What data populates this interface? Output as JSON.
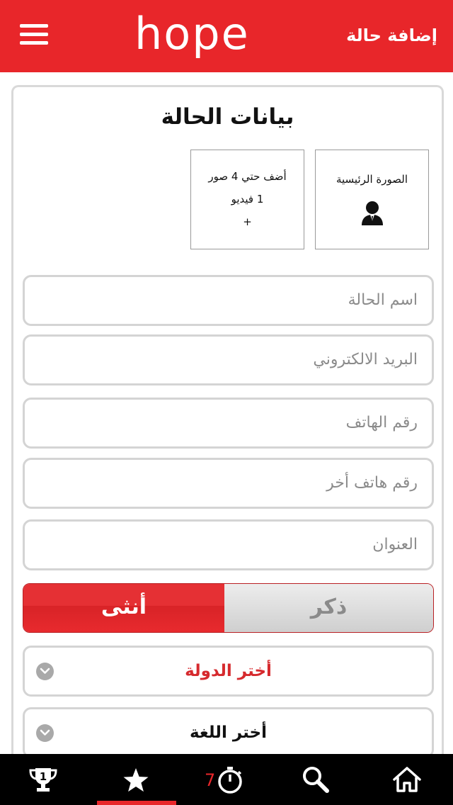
{
  "header": {
    "logo": "hope",
    "title": "إضافة حالة",
    "background": "#e8262a"
  },
  "card": {
    "title": "بيانات الحالة",
    "main_photo_label": "الصورة الرئيسية",
    "more_media": {
      "line1": "أضف حتي  4 صور",
      "line2": "1 فيديو",
      "plus": "+"
    }
  },
  "fields": {
    "case_name": "اسم الحالة",
    "email": "البريد الالكتروني",
    "phone": "رقم الهاتف",
    "phone2": "رقم هاتف أخر",
    "address": "العنوان"
  },
  "gender": {
    "male": "ذكر",
    "female": "أنثى",
    "selected": "female"
  },
  "selects": {
    "country": "أختر الدولة",
    "language": "أختر اللغة"
  },
  "colors": {
    "accent": "#e8262a",
    "country_text": "#d62a2e",
    "language_text": "#111111"
  },
  "bottom_nav": {
    "items": [
      "trophy-icon",
      "star-icon",
      "timer-icon",
      "search-icon",
      "home-icon"
    ],
    "active": "star-icon",
    "timer_count": "7",
    "trophy_number": "1"
  }
}
